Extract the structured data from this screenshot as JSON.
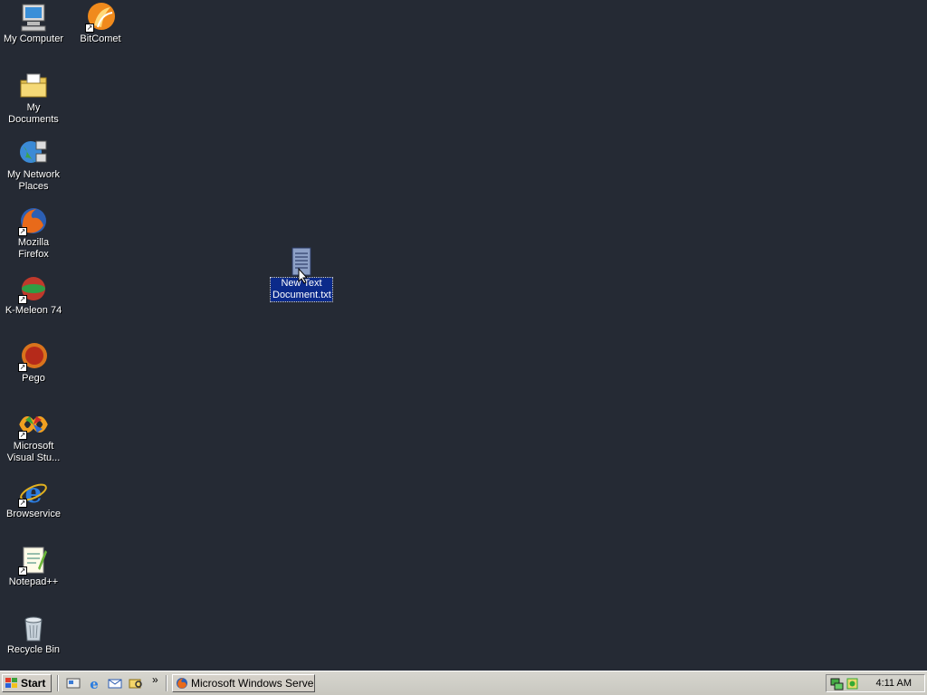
{
  "desktop": {
    "icons": [
      {
        "label": "My Computer",
        "icon": "my-computer-icon"
      },
      {
        "label": "BitComet",
        "icon": "bitcomet-icon"
      },
      {
        "label": "My Documents",
        "icon": "my-documents-icon"
      },
      {
        "label": "My Network Places",
        "icon": "network-places-icon"
      },
      {
        "label": "Mozilla Firefox",
        "icon": "firefox-icon"
      },
      {
        "label": "K-Meleon 74",
        "icon": "kmeleon-icon"
      },
      {
        "label": "Pego",
        "icon": "pego-icon"
      },
      {
        "label": "Microsoft Visual Stu...",
        "icon": "visual-studio-icon"
      },
      {
        "label": "Browservice",
        "icon": "ie-icon"
      },
      {
        "label": "Notepad++",
        "icon": "notepadpp-icon"
      },
      {
        "label": "Recycle Bin",
        "icon": "recycle-bin-icon"
      },
      {
        "label": "New Text Document.txt",
        "icon": "text-document-icon",
        "selected": true
      }
    ]
  },
  "taskbar": {
    "start_label": "Start",
    "quick_launch": [
      "show-desktop-icon",
      "ie-icon",
      "outlook-icon",
      "explorer-icon"
    ],
    "more_label": "»",
    "tasks": [
      {
        "label": "Microsoft Windows Serve...",
        "icon": "firefox-icon"
      }
    ],
    "tray": {
      "icons": [
        "network-icon",
        "security-icon"
      ],
      "clock": "4:11 AM"
    }
  },
  "colors": {
    "desktop": "#252a34",
    "taskbar": "#d4d0c8",
    "selection": "#0b2a8a"
  }
}
